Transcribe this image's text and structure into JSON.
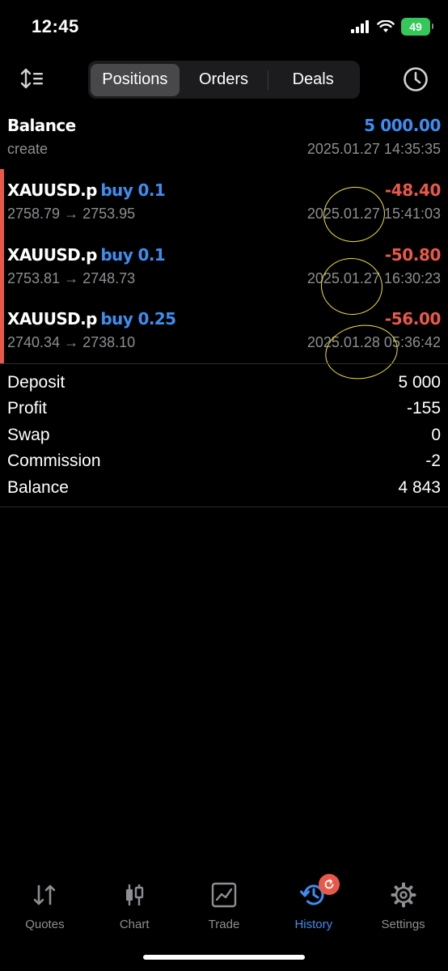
{
  "status": {
    "time": "12:45",
    "battery": "49"
  },
  "tabs": [
    {
      "label": "Positions",
      "active": true
    },
    {
      "label": "Orders",
      "active": false
    },
    {
      "label": "Deals",
      "active": false
    }
  ],
  "balance_row": {
    "title": "Balance",
    "amount": "5 000.00",
    "subtitle": "create",
    "datetime": "2025.01.27 14:35:35"
  },
  "positions": [
    {
      "symbol": "XAUUSD.p",
      "side": "buy 0.1",
      "profit": "-48.40",
      "prices": "2758.79 → 2753.95",
      "datetime": "2025.01.27 15:41:03"
    },
    {
      "symbol": "XAUUSD.p",
      "side": "buy 0.1",
      "profit": "-50.80",
      "prices": "2753.81 → 2748.73",
      "datetime": "2025.01.27 16:30:23"
    },
    {
      "symbol": "XAUUSD.p",
      "side": "buy 0.25",
      "profit": "-56.00",
      "prices": "2740.34 → 2738.10",
      "datetime": "2025.01.28 05:36:42"
    }
  ],
  "summary": [
    {
      "label": "Deposit",
      "value": "5 000"
    },
    {
      "label": "Profit",
      "value": "-155"
    },
    {
      "label": "Swap",
      "value": "0"
    },
    {
      "label": "Commission",
      "value": "-2"
    },
    {
      "label": "Balance",
      "value": "4 843"
    }
  ],
  "tabbar": [
    {
      "label": "Quotes",
      "icon": "quotes-icon"
    },
    {
      "label": "Chart",
      "icon": "candlestick-icon"
    },
    {
      "label": "Trade",
      "icon": "trade-chart-icon"
    },
    {
      "label": "History",
      "icon": "history-icon",
      "active": true
    },
    {
      "label": "Settings",
      "icon": "gear-icon"
    }
  ],
  "colors": {
    "accent": "#3d8ef0",
    "loss": "#e9594a",
    "annotation": "#f2e434",
    "battery": "#34c759"
  }
}
